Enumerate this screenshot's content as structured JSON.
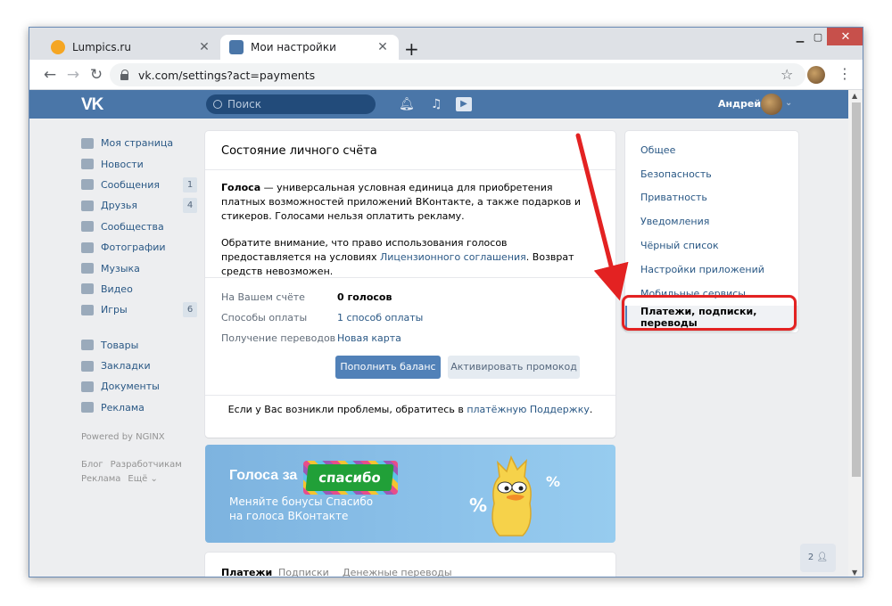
{
  "browser": {
    "tabs": [
      {
        "title": "Lumpics.ru",
        "favicon_color": "#f5a623"
      },
      {
        "title": "Мои настройки",
        "favicon_color": "#4a76a8"
      }
    ],
    "url": "vk.com/settings?act=payments"
  },
  "header": {
    "logo": "VK",
    "search_placeholder": "Поиск",
    "user_name": "Андрей"
  },
  "leftnav": {
    "items": [
      {
        "label": "Моя страница",
        "count": ""
      },
      {
        "label": "Новости",
        "count": ""
      },
      {
        "label": "Сообщения",
        "count": "1"
      },
      {
        "label": "Друзья",
        "count": "4"
      },
      {
        "label": "Сообщества",
        "count": ""
      },
      {
        "label": "Фотографии",
        "count": ""
      },
      {
        "label": "Музыка",
        "count": ""
      },
      {
        "label": "Видео",
        "count": ""
      },
      {
        "label": "Игры",
        "count": "6"
      }
    ],
    "items2": [
      {
        "label": "Товары"
      },
      {
        "label": "Закладки"
      },
      {
        "label": "Документы"
      },
      {
        "label": "Реклама"
      }
    ],
    "powered": "Powered by NGINX",
    "footer": [
      "Блог",
      "Разработчикам",
      "Реклама",
      "Ещё ⌄"
    ]
  },
  "card": {
    "title": "Состояние личного счёта",
    "p1_bold": "Голоса",
    "p1_rest": " — универсальная условная единица для приобретения платных возможностей приложений ВКонтакте, а также подарков и стикеров. Голосами нельзя оплатить рекламу.",
    "p2_start": "Обратите внимание, что право использования голосов предоставляется на условиях ",
    "p2_link": "Лицензионного соглашения",
    "p2_end": ". Возврат средств невозможен.",
    "rows": [
      {
        "label": "На Вашем счёте",
        "value": "0 голосов"
      },
      {
        "label": "Способы оплаты",
        "value": "1 способ оплаты"
      },
      {
        "label": "Получение переводов",
        "value": "Новая карта"
      }
    ],
    "btn_topup": "Пополнить баланс",
    "btn_promo": "Активировать промокод",
    "support_start": "Если у Вас возникли проблемы, обратитесь в ",
    "support_link": "платёжную Поддержку",
    "support_end": "."
  },
  "banner": {
    "heading": "Голоса за",
    "brand": "спасибо",
    "sub1": "Меняйте бонусы Спасибо",
    "sub2": "на голоса ВКонтакте",
    "pct": "%"
  },
  "bottom_tabs": [
    "Платежи",
    "Подписки",
    "Денежные переводы"
  ],
  "rightmenu": {
    "items": [
      {
        "label": "Общее"
      },
      {
        "label": "Безопасность"
      },
      {
        "label": "Приватность"
      },
      {
        "label": "Уведомления"
      },
      {
        "label": "Чёрный список"
      },
      {
        "label": "Настройки приложений"
      },
      {
        "label": "Мобильные сервисы"
      },
      {
        "label": "Платежи, подписки, переводы"
      }
    ],
    "active_index": 7
  },
  "chat_count": "2",
  "colors": {
    "vk_blue": "#4a76a8",
    "annotation_red": "#e32222",
    "link": "#2a5885"
  }
}
